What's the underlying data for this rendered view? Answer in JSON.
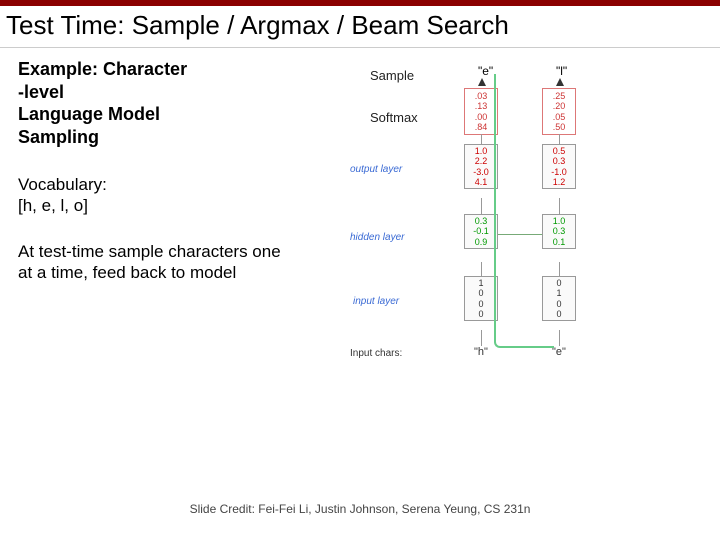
{
  "title": "Test Time: Sample / Argmax / Beam Search",
  "left": {
    "heading_l1": "Example: Character",
    "heading_l2": "-level",
    "heading_l3": "Language Model",
    "heading_l4": "Sampling",
    "vocab_label": "Vocabulary:",
    "vocab_value": "[h, e, l, o]",
    "test_time": "At test-time sample characters one at a time, feed back to model"
  },
  "labels": {
    "sample": "Sample",
    "softmax": "Softmax",
    "output_layer": "output layer",
    "hidden_layer": "hidden layer",
    "input_layer": "input layer",
    "input_chars": "Input chars:"
  },
  "sampled": {
    "c1": "\"e\"",
    "c2": "\"l\""
  },
  "softmax_boxes": {
    "b1": [
      ".03",
      ".13",
      ".00",
      ".84"
    ],
    "b2": [
      ".25",
      ".20",
      ".05",
      ".50"
    ]
  },
  "vectors": {
    "out1": [
      "1.0",
      "2.2",
      "-3.0",
      "4.1"
    ],
    "out2": [
      "0.5",
      "0.3",
      "-1.0",
      "1.2"
    ],
    "hid1": [
      "0.3",
      "-0.1",
      "0.9"
    ],
    "hid2": [
      "1.0",
      "0.3",
      "0.1"
    ],
    "in1": [
      "1",
      "0",
      "0",
      "0"
    ],
    "in2": [
      "0",
      "1",
      "0",
      "0"
    ]
  },
  "input_chars": {
    "ci1": "\"h\"",
    "ci2": "\"e\""
  },
  "credit": "Slide Credit: Fei-Fei Li, Justin Johnson, Serena Yeung, CS 231n"
}
